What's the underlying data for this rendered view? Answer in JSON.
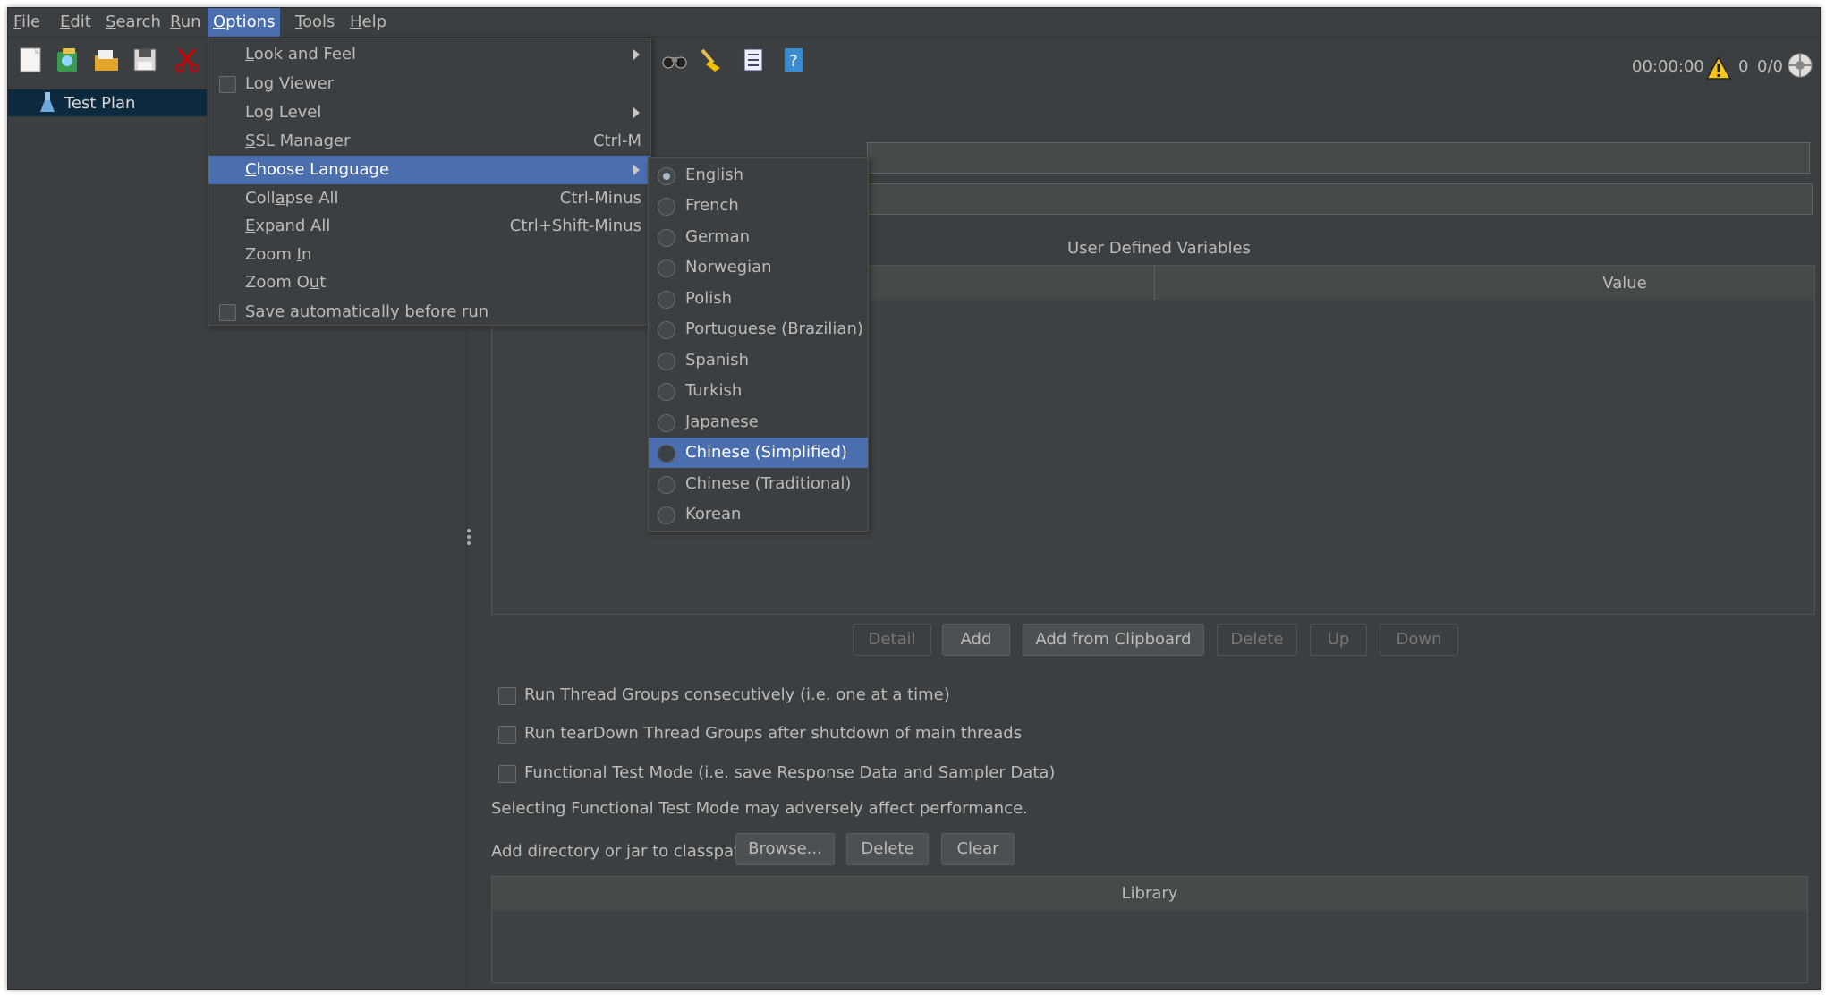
{
  "menubar": {
    "items": [
      {
        "pre": "",
        "mn": "F",
        "post": "ile"
      },
      {
        "pre": "",
        "mn": "E",
        "post": "dit"
      },
      {
        "pre": "",
        "mn": "S",
        "post": "earch"
      },
      {
        "pre": "",
        "mn": "R",
        "post": "un"
      },
      {
        "pre": "",
        "mn": "O",
        "post": "ptions"
      },
      {
        "pre": "",
        "mn": "T",
        "post": "ools"
      },
      {
        "pre": "",
        "mn": "H",
        "post": "elp"
      }
    ]
  },
  "status": {
    "elapsed": "00:00:00",
    "warnings": "0",
    "threads": "0/0"
  },
  "tree": {
    "root_label": "Test Plan"
  },
  "options_menu": {
    "items": [
      {
        "pre": "",
        "mn": "L",
        "post": "ook and Feel",
        "shortcut": ""
      },
      {
        "pre": "Log Viewer",
        "mn": "",
        "post": "",
        "shortcut": ""
      },
      {
        "pre": "Log Level",
        "mn": "",
        "post": "",
        "shortcut": ""
      },
      {
        "pre": "",
        "mn": "S",
        "post": "SL Manager",
        "shortcut": "Ctrl-M"
      },
      {
        "pre": "",
        "mn": "C",
        "post": "hoose Language",
        "shortcut": ""
      },
      {
        "pre": "Coll",
        "mn": "a",
        "post": "pse All",
        "shortcut": "Ctrl-Minus"
      },
      {
        "pre": "",
        "mn": "E",
        "post": "xpand All",
        "shortcut": "Ctrl+Shift-Minus"
      },
      {
        "pre": "Zoom ",
        "mn": "I",
        "post": "n",
        "shortcut": ""
      },
      {
        "pre": "Zoom O",
        "mn": "u",
        "post": "t",
        "shortcut": ""
      },
      {
        "pre": "Save automatically before run",
        "mn": "",
        "post": "",
        "shortcut": ""
      }
    ]
  },
  "language_menu": {
    "items": [
      "English",
      "French",
      "German",
      "Norwegian",
      "Polish",
      "Portuguese (Brazilian)",
      "Spanish",
      "Turkish",
      "Japanese",
      "Chinese (Simplified)",
      "Chinese (Traditional)",
      "Korean"
    ],
    "selected": "English",
    "highlighted": "Chinese (Simplified)"
  },
  "variables": {
    "title": "User Defined Variables",
    "col_value": "Value"
  },
  "buttons": {
    "detail": "Detail",
    "add": "Add",
    "add_clipboard": "Add from Clipboard",
    "delete": "Delete",
    "up": "Up",
    "down": "Down"
  },
  "options": {
    "consecutive": "Run Thread Groups consecutively (i.e. one at a time)",
    "teardown": "Run tearDown Thread Groups after shutdown of main threads",
    "functional": "Functional Test Mode (i.e. save Response Data and Sampler Data)",
    "functional_note": "Selecting Functional Test Mode may adversely affect performance."
  },
  "classpath": {
    "label": "Add directory or jar to classpath",
    "browse": "Browse...",
    "delete": "Delete",
    "clear": "Clear",
    "library_header": "Library"
  }
}
